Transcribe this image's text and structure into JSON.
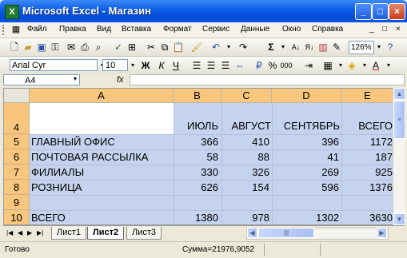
{
  "window": {
    "title": "Microsoft Excel - Магазин",
    "app_icon": "X",
    "minimize": "_",
    "maximize": "□",
    "close": "×"
  },
  "menu": {
    "items": [
      "Файл",
      "Правка",
      "Вид",
      "Вставка",
      "Формат",
      "Сервис",
      "Данные",
      "Окно",
      "Справка"
    ],
    "doc_controls": [
      "_",
      "□",
      "×"
    ]
  },
  "toolbar_standard": {
    "zoom": "126%"
  },
  "toolbar_format": {
    "font_name": "Arial Cyr",
    "font_size": "10",
    "bold": "Ж",
    "italic": "К",
    "underline": "Ч"
  },
  "formula": {
    "name_box": "A4",
    "fx": "fx",
    "value": ""
  },
  "grid": {
    "columns": [
      "A",
      "B",
      "C",
      "D",
      "E"
    ],
    "rows": [
      {
        "num": "4",
        "cells": [
          "",
          "ИЮЛЬ",
          "АВГУСТ",
          "СЕНТЯБРЬ",
          "ВСЕГО"
        ]
      },
      {
        "num": "5",
        "cells": [
          "ГЛАВНЫЙ ОФИС",
          "366",
          "410",
          "396",
          "1172"
        ]
      },
      {
        "num": "6",
        "cells": [
          "ПОЧТОВАЯ РАССЫЛКА",
          "58",
          "88",
          "41",
          "187"
        ]
      },
      {
        "num": "7",
        "cells": [
          "ФИЛИАЛЫ",
          "330",
          "326",
          "269",
          "925"
        ]
      },
      {
        "num": "8",
        "cells": [
          "РОЗНИЦА",
          "626",
          "154",
          "596",
          "1376"
        ]
      },
      {
        "num": "9",
        "cells": [
          "",
          "",
          "",
          "",
          ""
        ]
      },
      {
        "num": "10",
        "cells": [
          "ВСЕГО",
          "1380",
          "978",
          "1302",
          "3630"
        ]
      }
    ]
  },
  "sheets": {
    "tabs": [
      "Лист1",
      "Лист2",
      "Лист3"
    ],
    "active": "Лист2"
  },
  "status": {
    "ready": "Готово",
    "sum": "Сумма=21976,9052"
  },
  "colors": {
    "title_bar": "#0a5ce8",
    "selection": "#c5d3ee",
    "header_selected": "#f8c67c"
  }
}
